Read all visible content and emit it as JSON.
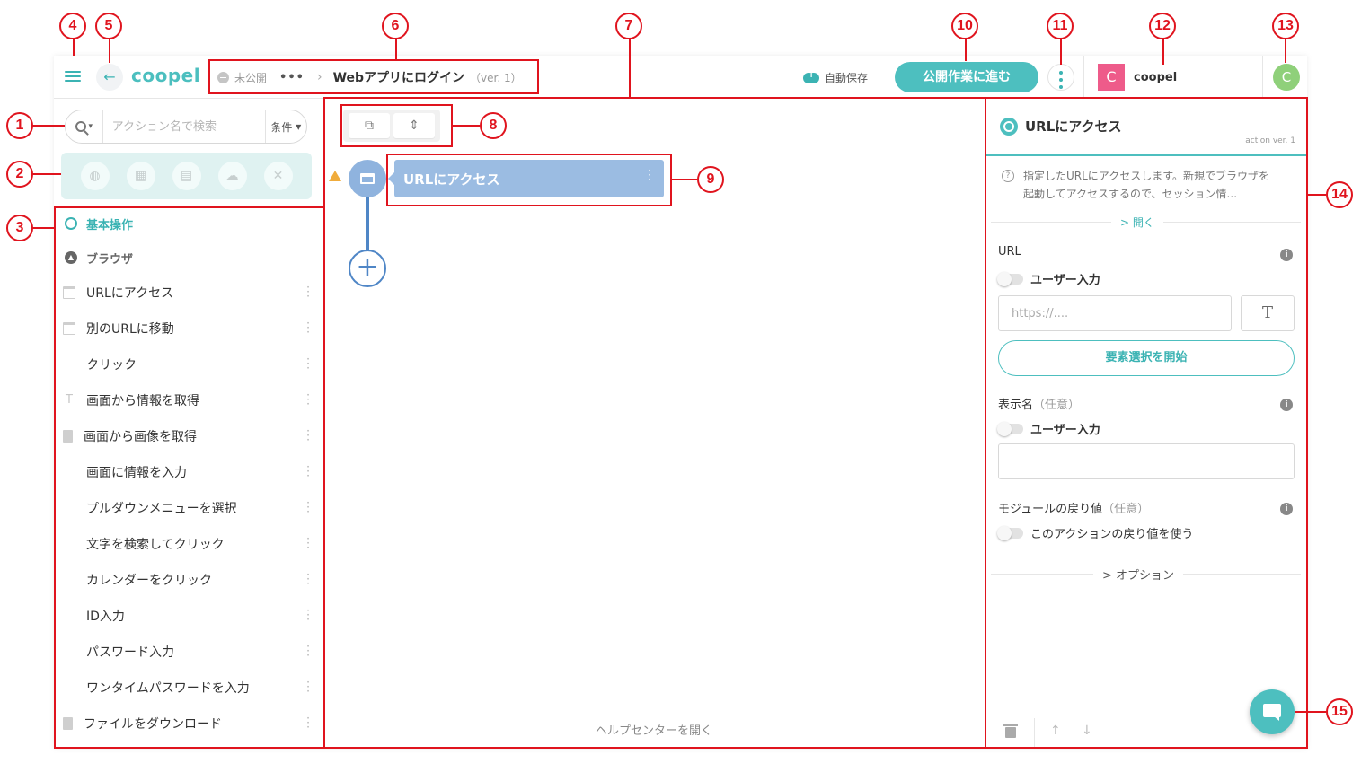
{
  "topbar": {
    "logo": "coopel",
    "status": "未公開",
    "more": "•••",
    "flow_name": "Webアプリにログイン",
    "version": "（ver. 1）",
    "autosave": "自動保存",
    "publish_button": "公開作業に進む",
    "workspace_initial": "C",
    "workspace_name": "coopel",
    "user_initial": "C"
  },
  "left": {
    "search_placeholder": "アクション名で検索",
    "condition_label": "条件",
    "category_icons": [
      "globe-icon",
      "excel-icon",
      "file-icon",
      "cloud-icon",
      "tools-icon"
    ],
    "section_basic": "基本操作",
    "section_browser": "ブラウザ",
    "items": [
      {
        "label": "URLにアクセス",
        "icon": "window-icon"
      },
      {
        "label": "別のURLに移動",
        "icon": "window-icon"
      },
      {
        "label": "クリック",
        "icon": ""
      },
      {
        "label": "画面から情報を取得",
        "icon": "text-icon"
      },
      {
        "label": "画面から画像を取得",
        "icon": "document-icon"
      },
      {
        "label": "画面に情報を入力",
        "icon": ""
      },
      {
        "label": "プルダウンメニューを選択",
        "icon": ""
      },
      {
        "label": "文字を検索してクリック",
        "icon": ""
      },
      {
        "label": "カレンダーをクリック",
        "icon": ""
      },
      {
        "label": "ID入力",
        "icon": ""
      },
      {
        "label": "パスワード入力",
        "icon": ""
      },
      {
        "label": "ワンタイムパスワードを入力",
        "icon": ""
      },
      {
        "label": "ファイルをダウンロード",
        "icon": "document-icon"
      }
    ]
  },
  "canvas": {
    "node_label": "URLにアクセス",
    "help_link": "ヘルプセンターを開く"
  },
  "right": {
    "title": "URLにアクセス",
    "action_version": "action ver. 1",
    "description_line1": "指定したURLにアクセスします。新規でブラウザを",
    "description_line2": "起動してアクセスするので、セッション情...",
    "expand": "> 開く",
    "url_label": "URL",
    "user_input": "ユーザー入力",
    "url_placeholder": "https://....",
    "text_button": "T",
    "select_button": "要素選択を開始",
    "display_name_label": "表示名",
    "optional": "（任意）",
    "return_label": "モジュールの戻り値",
    "use_return": "このアクションの戻り値を使う",
    "options": "> オプション"
  },
  "annotations": [
    "1",
    "2",
    "3",
    "4",
    "5",
    "6",
    "7",
    "8",
    "9",
    "10",
    "11",
    "12",
    "13",
    "14",
    "15"
  ],
  "colors": {
    "accent": "#4dbfbf",
    "node": "#9bbce2",
    "connector": "#4f86c6",
    "annotation": "#e0141e",
    "warning": "#f0ac3c"
  }
}
